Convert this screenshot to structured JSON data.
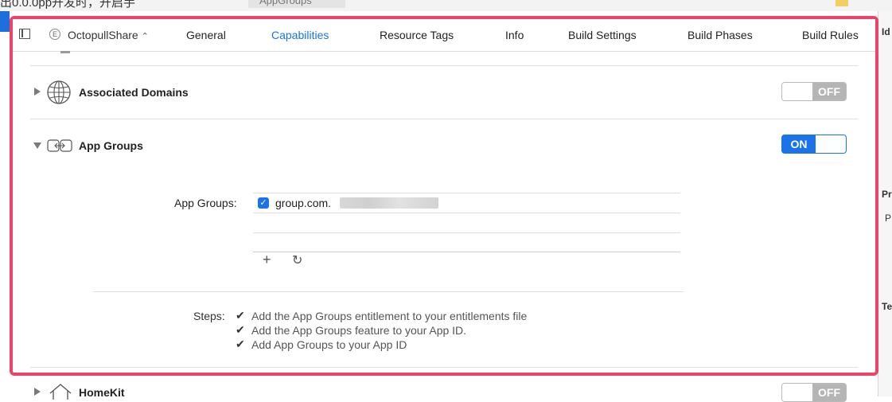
{
  "top_caption": "出0.0.0pp开发时，开启手",
  "top_path": "AppGroups",
  "target": {
    "name": "OctopullShare",
    "badge": "E"
  },
  "tabs": [
    {
      "label": "General",
      "selected": false
    },
    {
      "label": "Capabilities",
      "selected": true
    },
    {
      "label": "Resource Tags",
      "selected": false
    },
    {
      "label": "Info",
      "selected": false
    },
    {
      "label": "Build Settings",
      "selected": false
    },
    {
      "label": "Build Phases",
      "selected": false
    },
    {
      "label": "Build Rules",
      "selected": false
    }
  ],
  "capabilities": {
    "associated_domains": {
      "title": "Associated Domains",
      "switch": "OFF",
      "icon": "globe-icon"
    },
    "app_groups": {
      "title": "App Groups",
      "switch": "ON",
      "icon": "app-groups-icon",
      "field_label": "App Groups:",
      "groups": [
        {
          "id": "group.com.",
          "checked": true
        }
      ],
      "steps_label": "Steps:",
      "steps": [
        "Add the App Groups entitlement to your entitlements file",
        "Add the App Groups feature to your App ID.",
        "Add App Groups to your App ID"
      ]
    },
    "homekit": {
      "title": "HomeKit",
      "switch": "OFF",
      "icon": "house-icon"
    }
  },
  "right_panel": {
    "id_label": "Id",
    "pr_label": "Pr",
    "p_label": "P",
    "te_label": "Te"
  },
  "colors": {
    "accent": "#1a73e8",
    "highlight_frame": "#f0416a",
    "switch_off": "#b5b5b5"
  }
}
